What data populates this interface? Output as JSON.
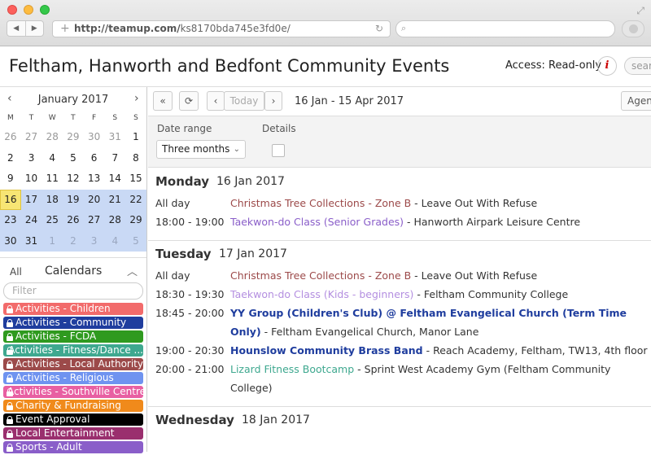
{
  "browser": {
    "nav_back": "◀",
    "nav_forward": "▶",
    "url_prefix": "http://teamup.com/",
    "url_path": "ks8170bda745e3fd0e/"
  },
  "header": {
    "title": "Feltham, Hanworth and Bedfont Community Events",
    "access": "Access: Read-only",
    "info_label": "i",
    "search_placeholder": "sear"
  },
  "mini_calendar": {
    "month": "January 2017",
    "weekdays": [
      "M",
      "T",
      "W",
      "T",
      "F",
      "S",
      "S"
    ],
    "weeks": [
      [
        {
          "d": "26",
          "o": true
        },
        {
          "d": "27",
          "o": true
        },
        {
          "d": "28",
          "o": true
        },
        {
          "d": "29",
          "o": true
        },
        {
          "d": "30",
          "o": true
        },
        {
          "d": "31",
          "o": true
        },
        {
          "d": "1"
        }
      ],
      [
        {
          "d": "2"
        },
        {
          "d": "3"
        },
        {
          "d": "4"
        },
        {
          "d": "5"
        },
        {
          "d": "6"
        },
        {
          "d": "7"
        },
        {
          "d": "8"
        }
      ],
      [
        {
          "d": "9"
        },
        {
          "d": "10"
        },
        {
          "d": "11"
        },
        {
          "d": "12"
        },
        {
          "d": "13"
        },
        {
          "d": "14"
        },
        {
          "d": "15"
        }
      ],
      [
        {
          "d": "16",
          "r": true,
          "t": true
        },
        {
          "d": "17",
          "r": true
        },
        {
          "d": "18",
          "r": true
        },
        {
          "d": "19",
          "r": true
        },
        {
          "d": "20",
          "r": true
        },
        {
          "d": "21",
          "r": true
        },
        {
          "d": "22",
          "r": true
        }
      ],
      [
        {
          "d": "23",
          "r": true
        },
        {
          "d": "24",
          "r": true
        },
        {
          "d": "25",
          "r": true
        },
        {
          "d": "26",
          "r": true
        },
        {
          "d": "27",
          "r": true
        },
        {
          "d": "28",
          "r": true
        },
        {
          "d": "29",
          "r": true
        }
      ],
      [
        {
          "d": "30",
          "r": true
        },
        {
          "d": "31",
          "r": true
        },
        {
          "d": "1",
          "r": true,
          "o": true
        },
        {
          "d": "2",
          "r": true,
          "o": true
        },
        {
          "d": "3",
          "r": true,
          "o": true
        },
        {
          "d": "4",
          "r": true,
          "o": true
        },
        {
          "d": "5",
          "r": true,
          "o": true
        }
      ]
    ]
  },
  "calendars": {
    "all_label": "All",
    "label": "Calendars",
    "filter_placeholder": "Filter",
    "items": [
      {
        "name": "Activities - Children",
        "color": "#f26b6b"
      },
      {
        "name": "Activities - Community",
        "color": "#1f3d9e"
      },
      {
        "name": "Activities - FCDA",
        "color": "#2f9a1f"
      },
      {
        "name": "Activities - Fitness/Dance ...",
        "color": "#3ea88f"
      },
      {
        "name": "Activities - Local Authority",
        "color": "#9c4a4a"
      },
      {
        "name": "Activities - Religious",
        "color": "#6f93f0"
      },
      {
        "name": "Activities - Southville Centre",
        "color": "#e85fa2"
      },
      {
        "name": "Charity & Fundraising",
        "color": "#f08a1b"
      },
      {
        "name": "Event Approval",
        "color": "#000000"
      },
      {
        "name": "Local Entertainment",
        "color": "#9a2f6e"
      },
      {
        "name": "Sports - Adult",
        "color": "#8a5ec9"
      }
    ]
  },
  "toolbar": {
    "double_prev": "«",
    "refresh": "⟳",
    "prev": "‹",
    "today": "Today",
    "next": "›",
    "date_range": "16 Jan - 15 Apr 2017",
    "view": "Agen"
  },
  "options": {
    "date_range_label": "Date range",
    "date_range_value": "Three months",
    "details_label": "Details"
  },
  "days": [
    {
      "name": "Monday",
      "date": "16 Jan 2017",
      "events": [
        {
          "time": "All day",
          "title": "Christmas Tree Collections - Zone B",
          "color": "#9c4a4a",
          "bold": false,
          "rest": " - Leave Out With Refuse"
        },
        {
          "time": "18:00 - 19:00",
          "title": "Taekwon-do Class (Senior Grades)",
          "color": "#8a5ec9",
          "bold": false,
          "rest": " - Hanworth Airpark Leisure Centre"
        }
      ]
    },
    {
      "name": "Tuesday",
      "date": "17 Jan 2017",
      "events": [
        {
          "time": "All day",
          "title": "Christmas Tree Collections - Zone B",
          "color": "#9c4a4a",
          "bold": false,
          "rest": " - Leave Out With Refuse"
        },
        {
          "time": "18:30 - 19:30",
          "title": "Taekwon-do Class (Kids - beginners)",
          "color": "#b48fe0",
          "bold": false,
          "rest": " - Feltham Community College"
        },
        {
          "time": "18:45 - 20:00",
          "title": "YY Group (Children's Club) @ Feltham Evangelical Church (Term Time Only)",
          "color": "#1f3d9e",
          "bold": true,
          "rest": " - Feltham Evangelical Church, Manor Lane"
        },
        {
          "time": "19:00 - 20:30",
          "title": "Hounslow Community Brass Band",
          "color": "#1f3d9e",
          "bold": true,
          "rest": " - Reach Academy, Feltham, TW13, 4th floor"
        },
        {
          "time": "20:00 - 21:00",
          "title": "Lizard Fitness Bootcamp",
          "color": "#3ea88f",
          "bold": false,
          "rest": " - Sprint West Academy Gym (Feltham Community College)"
        }
      ]
    },
    {
      "name": "Wednesday",
      "date": "18 Jan 2017",
      "events": []
    }
  ]
}
